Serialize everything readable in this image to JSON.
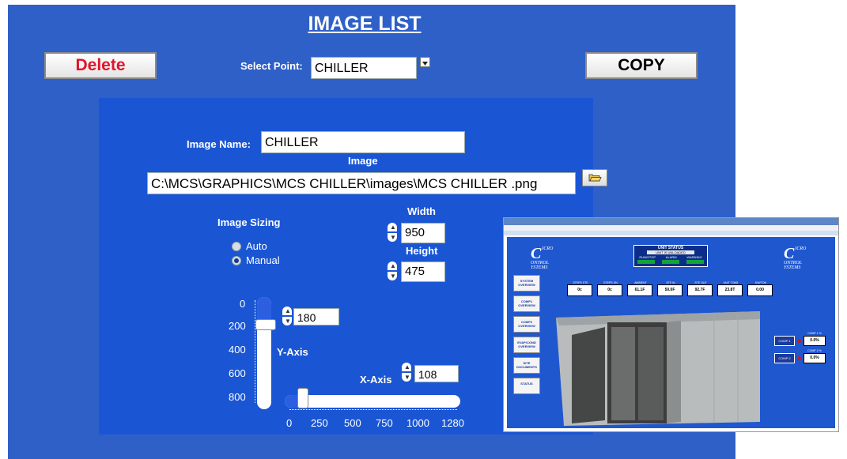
{
  "header": {
    "title": "IMAGE LIST",
    "delete_label": "Delete",
    "copy_label": "COPY",
    "select_point_label": "Select Point:",
    "select_point_value": "CHILLER"
  },
  "form": {
    "image_name_label": "Image Name:",
    "image_name_value": "CHILLER",
    "image_label": "Image",
    "image_path": "C:\\MCS\\GRAPHICS\\MCS CHILLER\\images\\MCS CHILLER .png",
    "sizing_label": "Image Sizing",
    "sizing_options": [
      "Auto",
      "Manual"
    ],
    "sizing_selected": "Manual",
    "width_label": "Width",
    "width_value": "950",
    "height_label": "Height",
    "height_value": "475",
    "y_axis_label": "Y-Axis",
    "y_axis_value": "180",
    "y_ticks": [
      "0",
      "200",
      "400",
      "600",
      "800"
    ],
    "x_axis_label": "X-Axis",
    "x_axis_value": "108",
    "x_ticks": [
      "0",
      "250",
      "500",
      "750",
      "1000",
      "1280"
    ]
  },
  "preview": {
    "unit_status_title": "UNIT STATUS",
    "unit_status_value": "UNIT IS UNLOADED",
    "status_headers": [
      "RUN/STOP",
      "ALARM",
      "WARNING"
    ],
    "side_buttons": [
      "SYSTEM OVERVIEW",
      "COMP1 OVERVIEW",
      "COMP2 OVERVIEW",
      "EVAP/COND OVERVIEW",
      "SITE DOCUMENTS",
      "STATUS"
    ],
    "values": [
      {
        "head": "STEPS STE",
        "val": "0c"
      },
      {
        "head": "STEPS ON",
        "val": "0c"
      },
      {
        "head": "AMBIENT",
        "val": "61.1F"
      },
      {
        "head": "STE IN",
        "val": "50.0F"
      },
      {
        "head": "STE OUT",
        "val": "92.7F"
      },
      {
        "head": "UNIT TONS",
        "val": "23.8T"
      },
      {
        "head": "KW/TON",
        "val": "0.00"
      }
    ],
    "comps": [
      {
        "label": "COMP 1",
        "head": "COMP 1 %",
        "val": "0.0%"
      },
      {
        "head": "COMP 2 %",
        "label": "COMP 2",
        "val": "0.0%"
      }
    ]
  },
  "colors": {
    "outer_bg": "#2e60c8",
    "panel_bg": "#1a56d4",
    "delete_text": "#e0142a"
  }
}
